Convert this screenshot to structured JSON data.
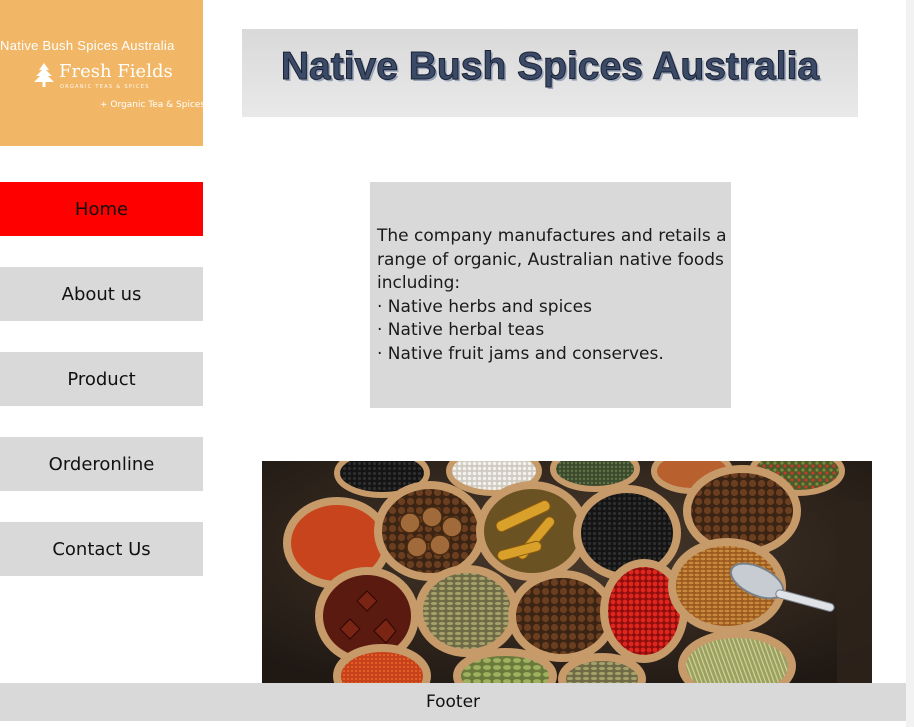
{
  "logo": {
    "brand_line": "Native  Bush  Spices  Australia",
    "name": "Fresh Fields",
    "subtitle": "ORGANIC TEAS & SPICES",
    "tagline": "+ Organic Tea & Spices",
    "icon": "tree-icon",
    "background": "#f2b766"
  },
  "header": {
    "title": "Native Bush Spices Australia"
  },
  "nav": {
    "items": [
      {
        "label": "Home",
        "active": true
      },
      {
        "label": "About us",
        "active": false
      },
      {
        "label": "Product",
        "active": false
      },
      {
        "label": "Orderonline",
        "active": false
      },
      {
        "label": "Contact Us",
        "active": false
      }
    ],
    "active_color": "#ff0000",
    "inactive_color": "#d9d9d9"
  },
  "content": {
    "intro": "The company manufactures and retails a range of organic, Australian native foods including:",
    "items": [
      "· Native herbs and spices",
      "· Native herbal teas",
      "· Native fruit jams and conserves."
    ]
  },
  "footer": {
    "label": "Footer"
  }
}
